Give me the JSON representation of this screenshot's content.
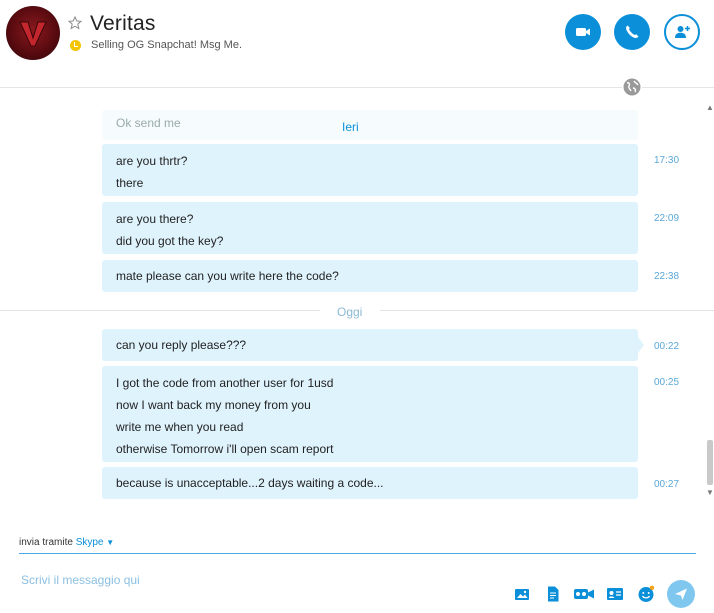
{
  "header": {
    "contact_name": "Veritas",
    "mood": "Selling OG Snapchat! Msg Me.",
    "status_color": "#f3c400",
    "buttons": [
      "video-call",
      "audio-call",
      "add-people"
    ],
    "accent": "#0a8fd8"
  },
  "conversation": {
    "faded_preview": "Ok send me",
    "days": {
      "yesterday": "Ieri",
      "today": "Oggi"
    },
    "messages": [
      {
        "lines": [
          "are you thrtr?",
          "there"
        ],
        "time": "17:30"
      },
      {
        "lines": [
          "are you there?",
          "did you got the key?"
        ],
        "time": "22:09"
      },
      {
        "lines": [
          "mate please can you write here the code?"
        ],
        "time": "22:38"
      },
      {
        "lines": [
          "can you reply please???"
        ],
        "time": "00:22"
      },
      {
        "lines": [
          "I got the code from another user for 1usd",
          "now I want back my money from you",
          "write me when you read",
          "otherwise Tomorrow i'll open scam report"
        ],
        "time": "00:25"
      },
      {
        "lines": [
          "because is unacceptable...2 days waiting a code..."
        ],
        "time": "00:27"
      }
    ]
  },
  "composer": {
    "via_label": "invia tramite",
    "via_service": "Skype",
    "placeholder": "Scrivi il messaggio qui",
    "tools": [
      "image-icon",
      "file-icon",
      "video-message-icon",
      "contact-card-icon",
      "emoticon-icon"
    ],
    "send_color": "#7fc7ef"
  }
}
